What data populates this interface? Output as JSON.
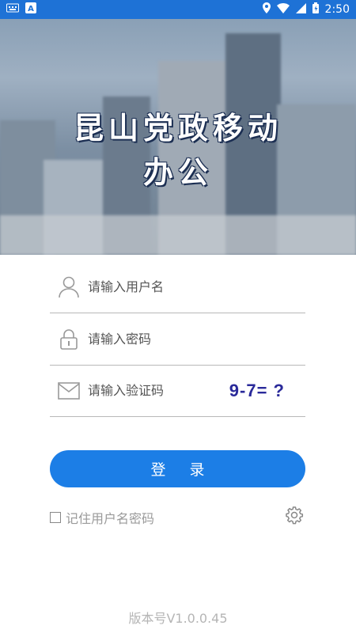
{
  "statusbar": {
    "time": "2:50",
    "left_icons": [
      "keyboard-icon",
      "a-notification-icon"
    ],
    "right_icons": [
      "location-icon",
      "wifi-icon",
      "signal-icon",
      "battery-icon"
    ]
  },
  "hero": {
    "title_line1": "昆山党政移动",
    "title_line2": "办公"
  },
  "form": {
    "username_placeholder": "请输入用户名",
    "password_placeholder": "请输入密码",
    "captcha_placeholder": "请输入验证码",
    "captcha_text": "9-7= ?",
    "login_label": "登录",
    "remember_label": "记住用户名密码"
  },
  "footer": {
    "version": "版本号V1.0.0.45"
  },
  "colors": {
    "statusbar": "#1e72d6",
    "primary": "#1c7ee6",
    "captcha": "#2a2a9a"
  }
}
